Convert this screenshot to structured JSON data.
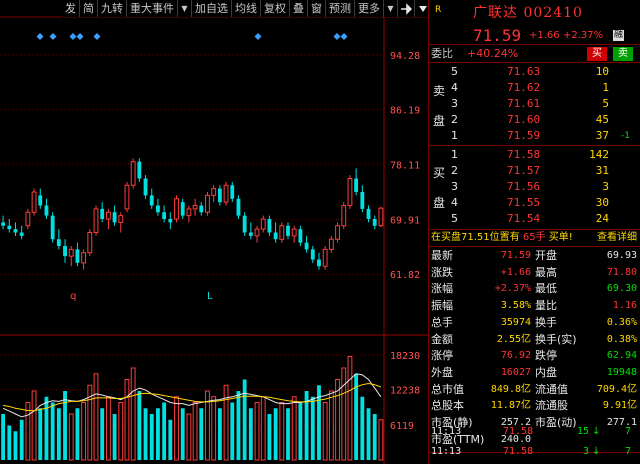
{
  "toolbar": {
    "items": [
      "发",
      "简",
      "九转",
      "重大事件",
      "加自选",
      "均线",
      "复权",
      "叠",
      "窗",
      "预测",
      "更多"
    ]
  },
  "stock": {
    "marker": "R",
    "name": "广联达",
    "code": "002410",
    "price": "71.59",
    "change": "+1.66",
    "change_pct": "+2.37%",
    "badge": "融"
  },
  "weibi": {
    "label": "委比",
    "value": "+40.24%",
    "buy": "买",
    "sell": "卖"
  },
  "side_labels": {
    "sell1": "卖",
    "sell2": "盘",
    "buy1": "买",
    "buy2": "盘"
  },
  "asks": [
    {
      "level": "5",
      "price": "71.63",
      "vol": "10",
      "delta": ""
    },
    {
      "level": "4",
      "price": "71.62",
      "vol": "1",
      "delta": ""
    },
    {
      "level": "3",
      "price": "71.61",
      "vol": "5",
      "delta": ""
    },
    {
      "level": "2",
      "price": "71.60",
      "vol": "45",
      "delta": ""
    },
    {
      "level": "1",
      "price": "71.59",
      "vol": "37",
      "delta": "-1"
    }
  ],
  "bids": [
    {
      "level": "1",
      "price": "71.58",
      "vol": "142"
    },
    {
      "level": "2",
      "price": "71.57",
      "vol": "31"
    },
    {
      "level": "3",
      "price": "71.56",
      "vol": "3"
    },
    {
      "level": "4",
      "price": "71.55",
      "vol": "30"
    },
    {
      "level": "5",
      "price": "71.54",
      "vol": "24"
    }
  ],
  "notice": {
    "prefix": "在买盘",
    "price": "71.51",
    "mid": "位置有",
    "hands": "65手",
    "word": "买单!",
    "link": "查看详细"
  },
  "stats": [
    {
      "l1": "最新",
      "v1": "71.59",
      "c1": "red",
      "l2": "开盘",
      "v2": "69.93",
      "c2": "wht"
    },
    {
      "l1": "涨跌",
      "v1": "+1.66",
      "c1": "red",
      "l2": "最高",
      "v2": "71.80",
      "c2": "red"
    },
    {
      "l1": "涨幅",
      "v1": "+2.37%",
      "c1": "red",
      "l2": "最低",
      "v2": "69.30",
      "c2": "grn"
    },
    {
      "l1": "振幅",
      "v1": "3.58%",
      "c1": "yel",
      "l2": "量比",
      "v2": "1.16",
      "c2": "red"
    },
    {
      "l1": "总手",
      "v1": "35974",
      "c1": "yel",
      "l2": "换手",
      "v2": "0.36%",
      "c2": "yel"
    },
    {
      "l1": "金额",
      "v1": "2.55亿",
      "c1": "yel",
      "l2": "换手(实)",
      "v2": "0.38%",
      "c2": "yel"
    },
    {
      "l1": "涨停",
      "v1": "76.92",
      "c1": "red",
      "l2": "跌停",
      "v2": "62.94",
      "c2": "grn"
    },
    {
      "l1": "外盘",
      "v1": "16027",
      "c1": "red",
      "l2": "内盘",
      "v2": "19948",
      "c2": "grn"
    },
    {
      "l1": "总市值",
      "v1": "849.8亿",
      "c1": "yel",
      "l2": "流通值",
      "v2": "709.4亿",
      "c2": "yel"
    },
    {
      "l1": "总股本",
      "v1": "11.87亿",
      "c1": "yel",
      "l2": "流通股",
      "v2": "9.91亿",
      "c2": "yel"
    },
    {
      "l1": "市盈(静)",
      "v1": "257.2",
      "c1": "wht",
      "l2": "市盈(动)",
      "v2": "277.1",
      "c2": "wht"
    },
    {
      "l1": "市盈(TTM)",
      "v1": "240.0",
      "c1": "wht",
      "l2": "",
      "v2": "",
      "c2": "wht"
    }
  ],
  "ticks": [
    {
      "time": "11:13",
      "price": "71.58",
      "vol": "15",
      "n": "7"
    },
    {
      "time": "11:13",
      "price": "71.58",
      "vol": "3",
      "n": "7"
    }
  ],
  "chart_data": {
    "type": "candlestick",
    "price_ticks": [
      "94.28",
      "86.19",
      "78.11",
      "69.91",
      "61.82"
    ],
    "volume_ticks": [
      "18230",
      "12238",
      "6119"
    ],
    "price_ylim": [
      58,
      98
    ],
    "volume_ylim": [
      0,
      20000
    ],
    "markers": [
      {
        "i": 0,
        "label": "q"
      },
      {
        "i": 0,
        "label": "L"
      }
    ],
    "candles": [
      {
        "o": 69.5,
        "h": 70.5,
        "l": 68.5,
        "c": 69.0
      },
      {
        "o": 69.0,
        "h": 70.0,
        "l": 68.0,
        "c": 68.5
      },
      {
        "o": 68.5,
        "h": 69.5,
        "l": 67.5,
        "c": 68.0
      },
      {
        "o": 68.0,
        "h": 69.0,
        "l": 67.0,
        "c": 67.5
      },
      {
        "o": 69.0,
        "h": 71.5,
        "l": 68.5,
        "c": 71.0
      },
      {
        "o": 71.0,
        "h": 74.5,
        "l": 70.5,
        "c": 74.0
      },
      {
        "o": 73.5,
        "h": 74.5,
        "l": 71.5,
        "c": 72.0
      },
      {
        "o": 72.0,
        "h": 73.0,
        "l": 70.0,
        "c": 70.5
      },
      {
        "o": 70.5,
        "h": 71.0,
        "l": 66.5,
        "c": 67.0
      },
      {
        "o": 67.0,
        "h": 68.5,
        "l": 65.5,
        "c": 66.0
      },
      {
        "o": 66.0,
        "h": 67.0,
        "l": 63.5,
        "c": 64.5
      },
      {
        "o": 64.5,
        "h": 66.0,
        "l": 63.0,
        "c": 65.5
      },
      {
        "o": 65.5,
        "h": 66.5,
        "l": 63.0,
        "c": 63.5
      },
      {
        "o": 63.5,
        "h": 65.5,
        "l": 62.5,
        "c": 65.0
      },
      {
        "o": 65.0,
        "h": 68.5,
        "l": 64.5,
        "c": 68.0
      },
      {
        "o": 68.0,
        "h": 72.0,
        "l": 67.5,
        "c": 71.5
      },
      {
        "o": 71.5,
        "h": 72.5,
        "l": 69.5,
        "c": 70.0
      },
      {
        "o": 70.0,
        "h": 71.5,
        "l": 68.5,
        "c": 71.0
      },
      {
        "o": 71.0,
        "h": 72.0,
        "l": 69.0,
        "c": 69.5
      },
      {
        "o": 69.5,
        "h": 71.0,
        "l": 68.0,
        "c": 70.5
      },
      {
        "o": 71.5,
        "h": 75.5,
        "l": 71.0,
        "c": 75.0
      },
      {
        "o": 75.0,
        "h": 79.0,
        "l": 74.5,
        "c": 78.5
      },
      {
        "o": 78.5,
        "h": 79.0,
        "l": 75.5,
        "c": 76.0
      },
      {
        "o": 76.0,
        "h": 76.5,
        "l": 73.0,
        "c": 73.5
      },
      {
        "o": 73.5,
        "h": 74.5,
        "l": 71.5,
        "c": 72.0
      },
      {
        "o": 72.0,
        "h": 73.0,
        "l": 70.5,
        "c": 71.0
      },
      {
        "o": 71.0,
        "h": 72.0,
        "l": 69.5,
        "c": 70.0
      },
      {
        "o": 70.0,
        "h": 71.0,
        "l": 68.5,
        "c": 69.5
      },
      {
        "o": 70.0,
        "h": 73.5,
        "l": 69.5,
        "c": 73.0
      },
      {
        "o": 72.5,
        "h": 73.0,
        "l": 70.0,
        "c": 70.5
      },
      {
        "o": 70.5,
        "h": 72.0,
        "l": 69.5,
        "c": 71.5
      },
      {
        "o": 71.5,
        "h": 73.0,
        "l": 70.5,
        "c": 72.0
      },
      {
        "o": 72.0,
        "h": 72.5,
        "l": 70.5,
        "c": 71.0
      },
      {
        "o": 71.0,
        "h": 74.0,
        "l": 70.5,
        "c": 73.5
      },
      {
        "o": 73.5,
        "h": 75.0,
        "l": 72.5,
        "c": 74.5
      },
      {
        "o": 74.5,
        "h": 75.0,
        "l": 72.0,
        "c": 72.5
      },
      {
        "o": 72.5,
        "h": 75.5,
        "l": 72.0,
        "c": 75.0
      },
      {
        "o": 75.0,
        "h": 75.5,
        "l": 72.5,
        "c": 73.0
      },
      {
        "o": 73.0,
        "h": 73.5,
        "l": 70.0,
        "c": 70.5
      },
      {
        "o": 70.5,
        "h": 71.0,
        "l": 67.5,
        "c": 68.0
      },
      {
        "o": 68.0,
        "h": 69.5,
        "l": 67.0,
        "c": 67.5
      },
      {
        "o": 67.5,
        "h": 69.0,
        "l": 66.5,
        "c": 68.5
      },
      {
        "o": 68.5,
        "h": 70.5,
        "l": 68.0,
        "c": 70.0
      },
      {
        "o": 70.0,
        "h": 70.5,
        "l": 67.5,
        "c": 68.0
      },
      {
        "o": 68.0,
        "h": 69.5,
        "l": 66.5,
        "c": 67.0
      },
      {
        "o": 67.0,
        "h": 69.5,
        "l": 66.5,
        "c": 69.0
      },
      {
        "o": 69.0,
        "h": 69.5,
        "l": 67.0,
        "c": 67.5
      },
      {
        "o": 67.5,
        "h": 69.0,
        "l": 66.5,
        "c": 68.5
      },
      {
        "o": 68.5,
        "h": 69.0,
        "l": 66.0,
        "c": 66.5
      },
      {
        "o": 66.5,
        "h": 67.5,
        "l": 65.0,
        "c": 65.5
      },
      {
        "o": 65.5,
        "h": 66.0,
        "l": 63.5,
        "c": 64.0
      },
      {
        "o": 64.0,
        "h": 65.0,
        "l": 62.5,
        "c": 63.0
      },
      {
        "o": 63.0,
        "h": 66.0,
        "l": 62.5,
        "c": 65.5
      },
      {
        "o": 65.5,
        "h": 67.5,
        "l": 65.0,
        "c": 67.0
      },
      {
        "o": 67.0,
        "h": 69.5,
        "l": 66.5,
        "c": 69.0
      },
      {
        "o": 69.0,
        "h": 72.5,
        "l": 68.5,
        "c": 72.0
      },
      {
        "o": 72.0,
        "h": 76.5,
        "l": 71.5,
        "c": 76.0
      },
      {
        "o": 76.0,
        "h": 77.5,
        "l": 73.5,
        "c": 74.0
      },
      {
        "o": 74.0,
        "h": 75.0,
        "l": 71.0,
        "c": 71.5
      },
      {
        "o": 71.5,
        "h": 72.0,
        "l": 69.5,
        "c": 70.0
      },
      {
        "o": 70.0,
        "h": 70.5,
        "l": 68.5,
        "c": 69.0
      },
      {
        "o": 69.0,
        "h": 71.8,
        "l": 68.8,
        "c": 71.6
      }
    ],
    "volumes": [
      8,
      6,
      5,
      7,
      10,
      12,
      9,
      11,
      10,
      9,
      12,
      8,
      9,
      10,
      13,
      15,
      9,
      11,
      8,
      10,
      14,
      16,
      12,
      9,
      8,
      9,
      10,
      7,
      11,
      9,
      8,
      10,
      9,
      12,
      11,
      9,
      13,
      10,
      12,
      14,
      9,
      10,
      11,
      8,
      9,
      10,
      9,
      11,
      10,
      12,
      11,
      13,
      10,
      12,
      14,
      16,
      18,
      15,
      11,
      9,
      8,
      7
    ],
    "ma5": [
      9,
      8.5,
      8,
      7.5,
      7.8,
      8.5,
      9.5,
      10,
      10.3,
      10.2,
      10.5,
      10.3,
      10.2,
      10.5,
      11,
      11.5,
      11.3,
      11,
      10.8,
      10.5,
      11,
      12,
      12.5,
      12.2,
      11.5,
      11,
      10.5,
      10,
      9.8,
      9.8,
      9.5,
      9.8,
      10,
      10.2,
      10.4,
      10.5,
      10.8,
      11,
      11.3,
      11.6,
      11.4,
      11.2,
      11,
      10.5,
      10,
      9.8,
      9.8,
      10,
      10,
      10.2,
      10.6,
      11,
      11.2,
      11.6,
      12,
      13,
      14,
      15,
      14.8,
      14,
      12.5,
      11
    ],
    "ma10": [
      9.5,
      9.3,
      9,
      8.8,
      8.6,
      8.6,
      8.8,
      9,
      9.4,
      9.8,
      10,
      10.2,
      10.2,
      10.3,
      10.5,
      10.8,
      10.8,
      10.8,
      10.7,
      10.7,
      10.9,
      11.2,
      11.5,
      11.6,
      11.5,
      11.4,
      11.2,
      11,
      10.8,
      10.6,
      10.4,
      10.2,
      10.1,
      10.1,
      10.2,
      10.3,
      10.5,
      10.7,
      10.9,
      11.1,
      11.1,
      11.1,
      11,
      10.9,
      10.7,
      10.5,
      10.3,
      10.2,
      10.1,
      10.1,
      10.2,
      10.4,
      10.6,
      10.9,
      11.2,
      11.6,
      12.1,
      12.7,
      13.1,
      13.3,
      13.1,
      12.7
    ]
  }
}
